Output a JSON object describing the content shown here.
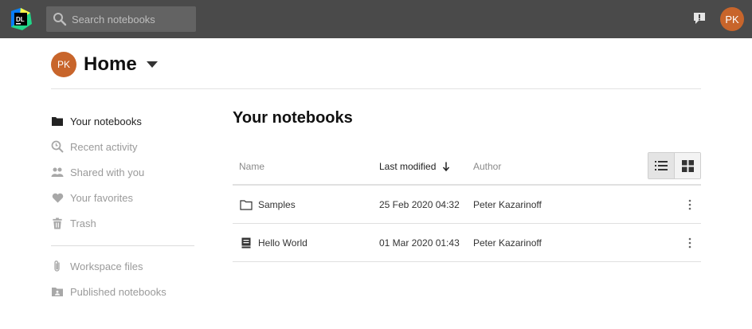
{
  "topbar": {
    "logo_text": "DL",
    "search_placeholder": "Search notebooks",
    "user_initials": "PK"
  },
  "home": {
    "initials": "PK",
    "title": "Home"
  },
  "sidebar": {
    "items": [
      {
        "label": "Your notebooks",
        "icon": "folder-icon",
        "active": true
      },
      {
        "label": "Recent activity",
        "icon": "recent-search-icon",
        "active": false
      },
      {
        "label": "Shared with you",
        "icon": "people-icon",
        "active": false
      },
      {
        "label": "Your favorites",
        "icon": "heart-icon",
        "active": false
      },
      {
        "label": "Trash",
        "icon": "trash-icon",
        "active": false
      }
    ],
    "secondary": [
      {
        "label": "Workspace files",
        "icon": "paperclip-icon"
      },
      {
        "label": "Published notebooks",
        "icon": "published-icon"
      }
    ]
  },
  "main": {
    "title": "Your notebooks",
    "columns": {
      "name": "Name",
      "modified": "Last modified",
      "author": "Author"
    },
    "rows": [
      {
        "icon": "folder-outline-icon",
        "name": "Samples",
        "modified": "25 Feb 2020 04:32",
        "author": "Peter Kazarinoff"
      },
      {
        "icon": "notebook-icon",
        "name": "Hello World",
        "modified": "01 Mar 2020 01:43",
        "author": "Peter Kazarinoff"
      }
    ]
  },
  "colors": {
    "topbar": "#4a4a4a",
    "avatar": "#c8652b",
    "search": "#636363"
  }
}
